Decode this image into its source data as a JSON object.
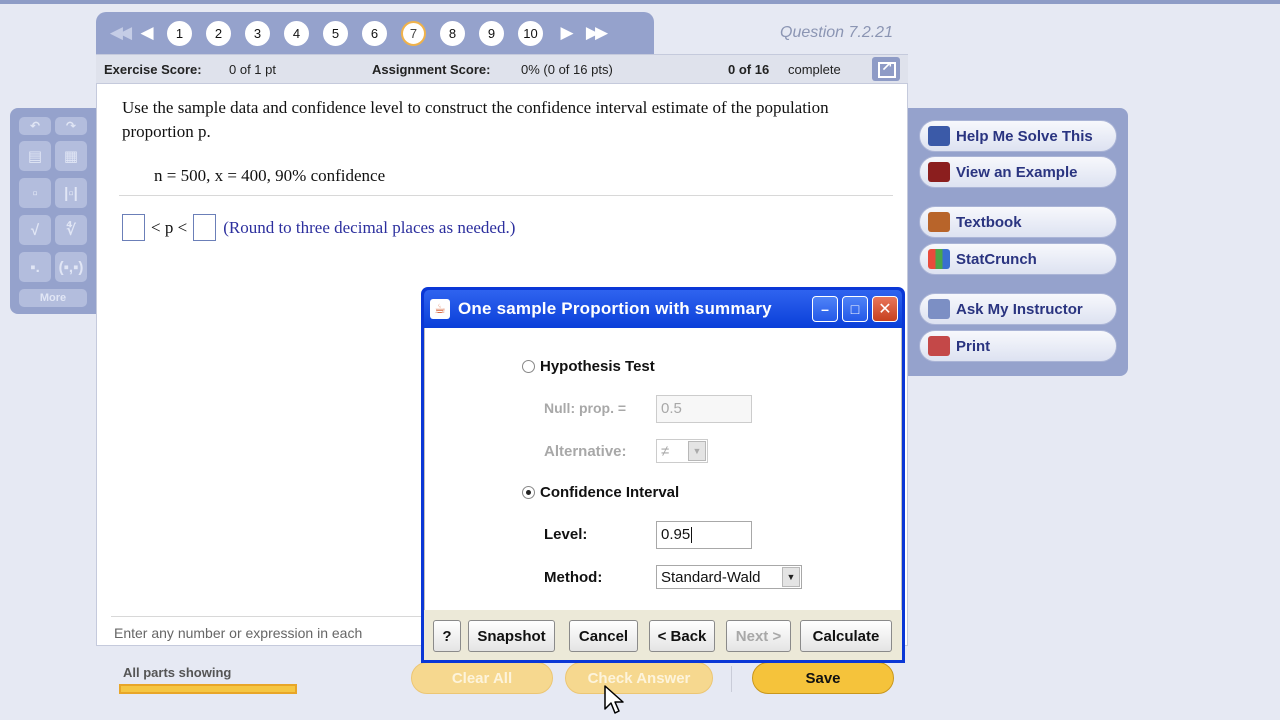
{
  "nav": {
    "question_numbers": [
      "1",
      "2",
      "3",
      "4",
      "5",
      "6",
      "7",
      "8",
      "9",
      "10"
    ],
    "current_question": "7",
    "question_id": "Question 7.2.21"
  },
  "score": {
    "exercise_label": "Exercise Score:",
    "exercise_value": "0 of 1 pt",
    "assignment_label": "Assignment Score:",
    "assignment_value": "0% (0 of 16 pts)",
    "complete_count": "0 of 16",
    "complete_label": "complete"
  },
  "question": {
    "text": "Use the sample data and confidence level to construct the confidence interval estimate of the population proportion p.",
    "given": "n = 500, x = 400, 90% confidence",
    "lt1": "< p <",
    "hint": "(Round to three decimal places as needed.)",
    "enter_hint": "Enter any number or expression in each"
  },
  "palette": {
    "more_label": "More"
  },
  "bottom": {
    "parts_label": "All parts showing",
    "progress": 1.0,
    "clear_all": "Clear All",
    "check_answer": "Check Answer",
    "save": "Save"
  },
  "tools": {
    "help": "Help Me Solve This",
    "example": "View an Example",
    "textbook": "Textbook",
    "statcrunch": "StatCrunch",
    "ask": "Ask My Instructor",
    "print": "Print"
  },
  "dialog": {
    "title": "One sample Proportion with summary",
    "hypothesis_test": "Hypothesis Test",
    "null_prop_label": "Null: prop. =",
    "null_prop_value": "0.5",
    "alternative_label": "Alternative:",
    "alternative_value": "≠",
    "confidence_interval": "Confidence Interval",
    "level_label": "Level:",
    "level_value": "0.95",
    "method_label": "Method:",
    "method_value": "Standard-Wald",
    "buttons": {
      "help": "?",
      "snapshot": "Snapshot",
      "cancel": "Cancel",
      "back": "< Back",
      "next": "Next >",
      "calculate": "Calculate"
    }
  },
  "colors": {
    "accent": "#95a2cc",
    "dialog_frame": "#0a37d6",
    "button_gold": "#f5c33b",
    "hint_text": "#2c2f9e"
  }
}
